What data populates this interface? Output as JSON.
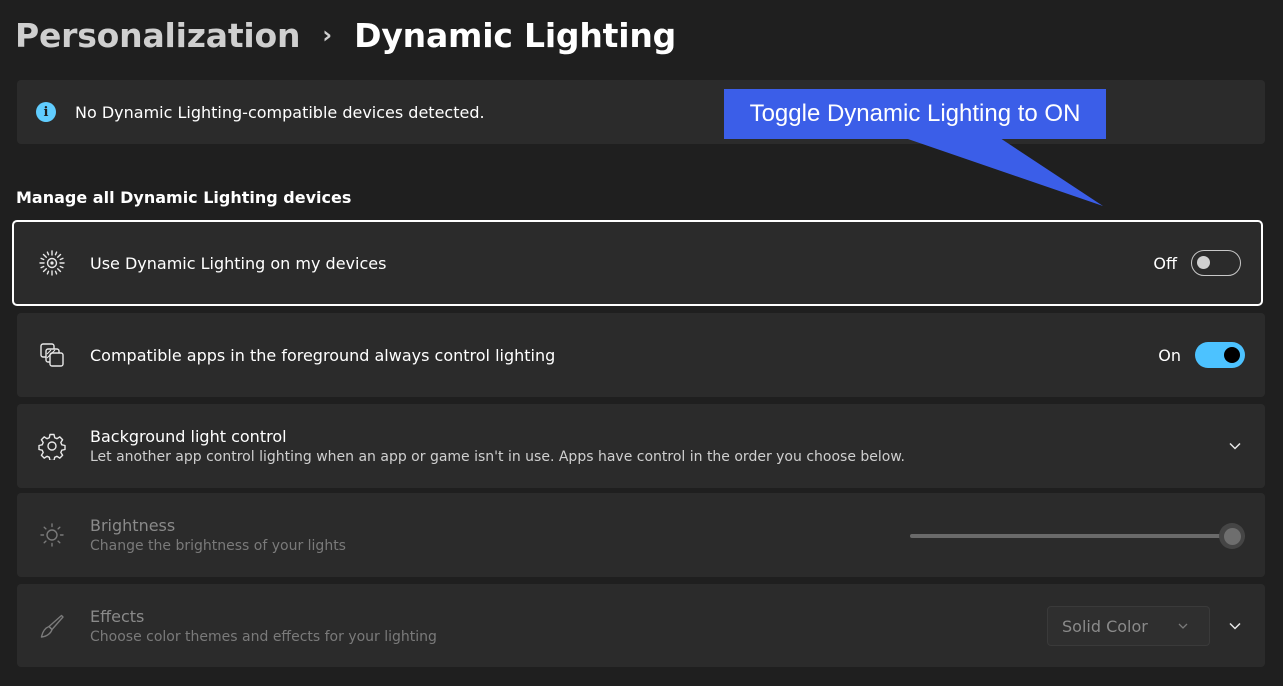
{
  "breadcrumb": {
    "parent": "Personalization",
    "separator": "›",
    "current": "Dynamic Lighting"
  },
  "info_bar": {
    "icon": "info-icon",
    "message": "No Dynamic Lighting-compatible devices detected."
  },
  "section": {
    "title": "Manage all Dynamic Lighting devices"
  },
  "settings": {
    "use_dynamic": {
      "icon": "sun-burst-icon",
      "title": "Use Dynamic Lighting on my devices",
      "state_label": "Off",
      "state": false
    },
    "foreground_apps": {
      "icon": "apps-layers-icon",
      "title": "Compatible apps in the foreground always control lighting",
      "state_label": "On",
      "state": true
    },
    "background_control": {
      "icon": "gear-icon",
      "title": "Background light control",
      "subtitle": "Let another app control lighting when an app or game isn't in use. Apps have control in the order you choose below."
    },
    "brightness": {
      "icon": "brightness-icon",
      "title": "Brightness",
      "subtitle": "Change the brightness of your lights",
      "value_percent": 100
    },
    "effects": {
      "icon": "paintbrush-icon",
      "title": "Effects",
      "subtitle": "Choose color themes and effects for your lighting",
      "selected": "Solid Color"
    }
  },
  "callout": {
    "text": "Toggle Dynamic Lighting to ON",
    "color": "#3b5ee8"
  },
  "colors": {
    "accent": "#4cc2ff",
    "background": "#1f1f1f",
    "card": "#2b2b2b"
  }
}
